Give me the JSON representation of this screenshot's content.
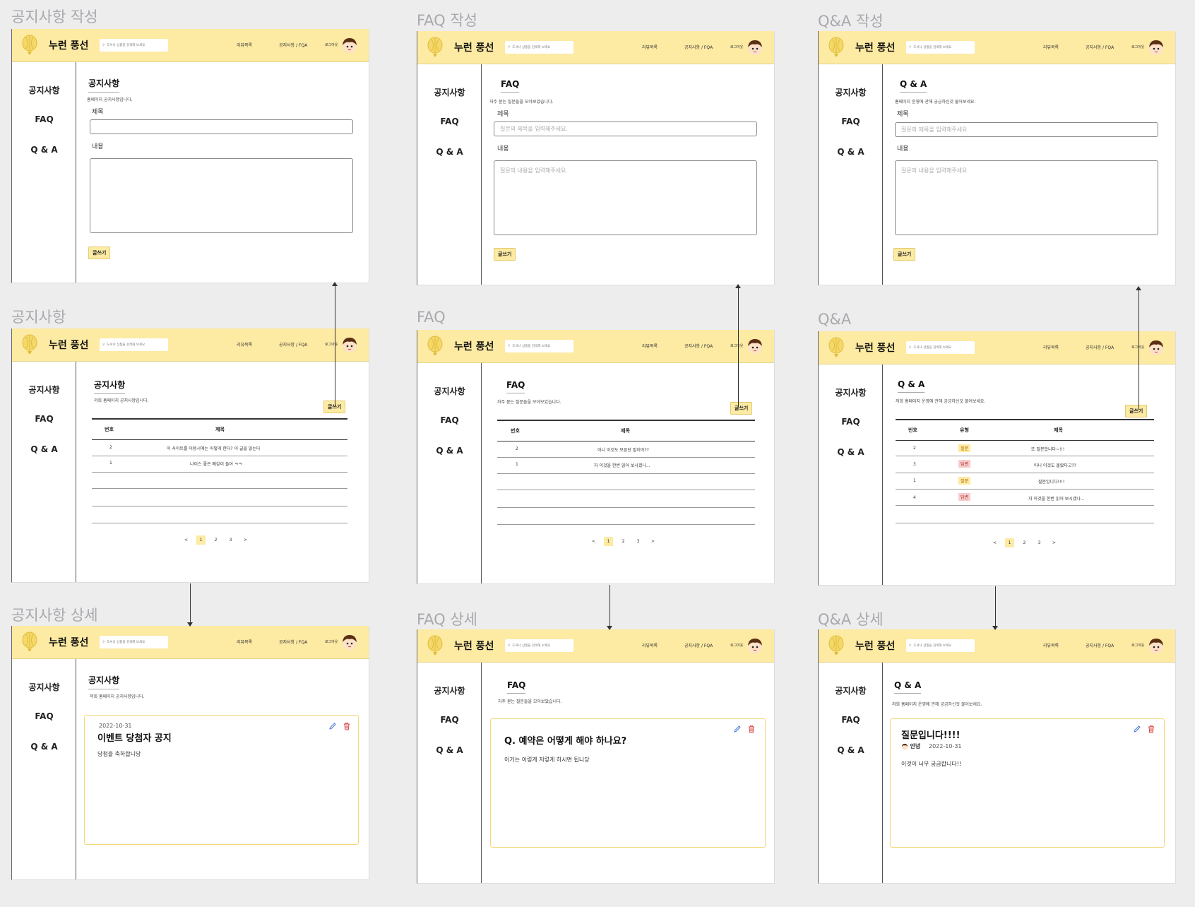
{
  "sections": {
    "notice_write": "공지사항 작성",
    "faq_write": "FAQ 작성",
    "qna_write": "Q&A 작성",
    "notice_list": "공지사항",
    "faq_list": "FAQ",
    "qna_list": "Q&A",
    "notice_detail": "공지사항 상세",
    "faq_detail": "FAQ 상세",
    "qna_detail": "Q&A 상세"
  },
  "header": {
    "brand": "누런 풍선",
    "search_placeholder": "도서나 상품을 검색해 보세요",
    "nav_reviews": "리뷰목록",
    "nav_notice": "공지사항 / FQA",
    "nav_logout": "로그아웃"
  },
  "sidebar": {
    "notice": "공지사항",
    "faq": "FAQ",
    "qna": "Q & A"
  },
  "notice_write": {
    "title": "공지사항",
    "subtitle": "홈페이지 공지사항입니다.",
    "title_label": "제목",
    "content_label": "내용",
    "title_placeholder": "",
    "content_placeholder": "",
    "submit": "글쓰기"
  },
  "faq_write": {
    "title": "FAQ",
    "subtitle": "자주 묻는 질문들을 모아보았습니다.",
    "title_label": "제목",
    "content_label": "내용",
    "title_placeholder": "질문의 제목을 입력해주세요.",
    "content_placeholder": "질문의 내용을 입력해주세요.",
    "submit": "글쓰기"
  },
  "qna_write": {
    "title": "Q & A",
    "subtitle": "홈페이지 운영에 관해 궁금하신것 물어보세요.",
    "title_label": "제목",
    "content_label": "내용",
    "title_placeholder": "질문의 제목을 입력해주세요",
    "content_placeholder": "질문의 내용을 입력해주세요",
    "submit": "글쓰기"
  },
  "notice_list": {
    "title": "공지사항",
    "subtitle": "저희 홈페이지 공지사항입니다.",
    "write_btn": "글쓰기",
    "col_no": "번호",
    "col_title": "제목",
    "rows": [
      {
        "no": "2",
        "title": "이 사이트를 이용시에는 어떻게 한다? 이 글을 읽는다"
      },
      {
        "no": "1",
        "title": "나이스 좋은 예감이 들어 ㅋㅋ"
      }
    ],
    "pages": [
      "<",
      "1",
      "2",
      "3",
      ">"
    ]
  },
  "faq_list": {
    "title": "FAQ",
    "subtitle": "자주 묻는 질문들을 모아보았습니다.",
    "write_btn": "글쓰기",
    "col_no": "번호",
    "col_title": "제목",
    "rows": [
      {
        "no": "2",
        "title": "아니 이것도 모른단 말이야??"
      },
      {
        "no": "1",
        "title": "자 이것을 한번 읽어 보시겠나..."
      }
    ],
    "pages": [
      "<",
      "1",
      "2",
      "3",
      ">"
    ]
  },
  "qna_list": {
    "title": "Q & A",
    "subtitle": "저희 홈페이지 운영에 관해 궁금하신것 물어보세요.",
    "write_btn": "글쓰기",
    "col_no": "번호",
    "col_type": "유형",
    "col_title": "제목",
    "rows": [
      {
        "no": "2",
        "type": "질문",
        "title": "또 질문합니다~!!!"
      },
      {
        "no": "3",
        "type": "답변",
        "title": "아니 이것도 몰랐다고??"
      },
      {
        "no": "1",
        "type": "질문",
        "title": "질문입니다!!!!"
      },
      {
        "no": "4",
        "type": "답변",
        "title": "자 이것을 한번 읽어 보시겠나..."
      }
    ],
    "pages": [
      "<",
      "1",
      "2",
      "3",
      ">"
    ]
  },
  "notice_detail": {
    "title": "공지사항",
    "subtitle": "저희 홈페이지 공지사항입니다.",
    "date": "2022-10-31",
    "post_title": "이벤트 당첨자 공지",
    "body": "당첨을 축하합니당"
  },
  "faq_detail": {
    "title": "FAQ",
    "subtitle": "자주 묻는 질문들을 모아보았습니다.",
    "post_title": "Q. 예약은 어떻게 해야 하나요?",
    "body": "이거는 이렇게 저렇게 하시면 됩니당"
  },
  "qna_detail": {
    "title": "Q & A",
    "subtitle": "저희 홈페이지 운영에 관해 궁금하신것 물어보세요.",
    "post_title": "질문입니다!!!!",
    "author": "안녕",
    "date": "2022-10-31",
    "body": "이것이 너무 궁금합니다!!"
  },
  "colors": {
    "header": "#fdeaa3",
    "accent": "#fdeaa3",
    "answer_tag": "#f7cccc",
    "background": "#ededee"
  }
}
